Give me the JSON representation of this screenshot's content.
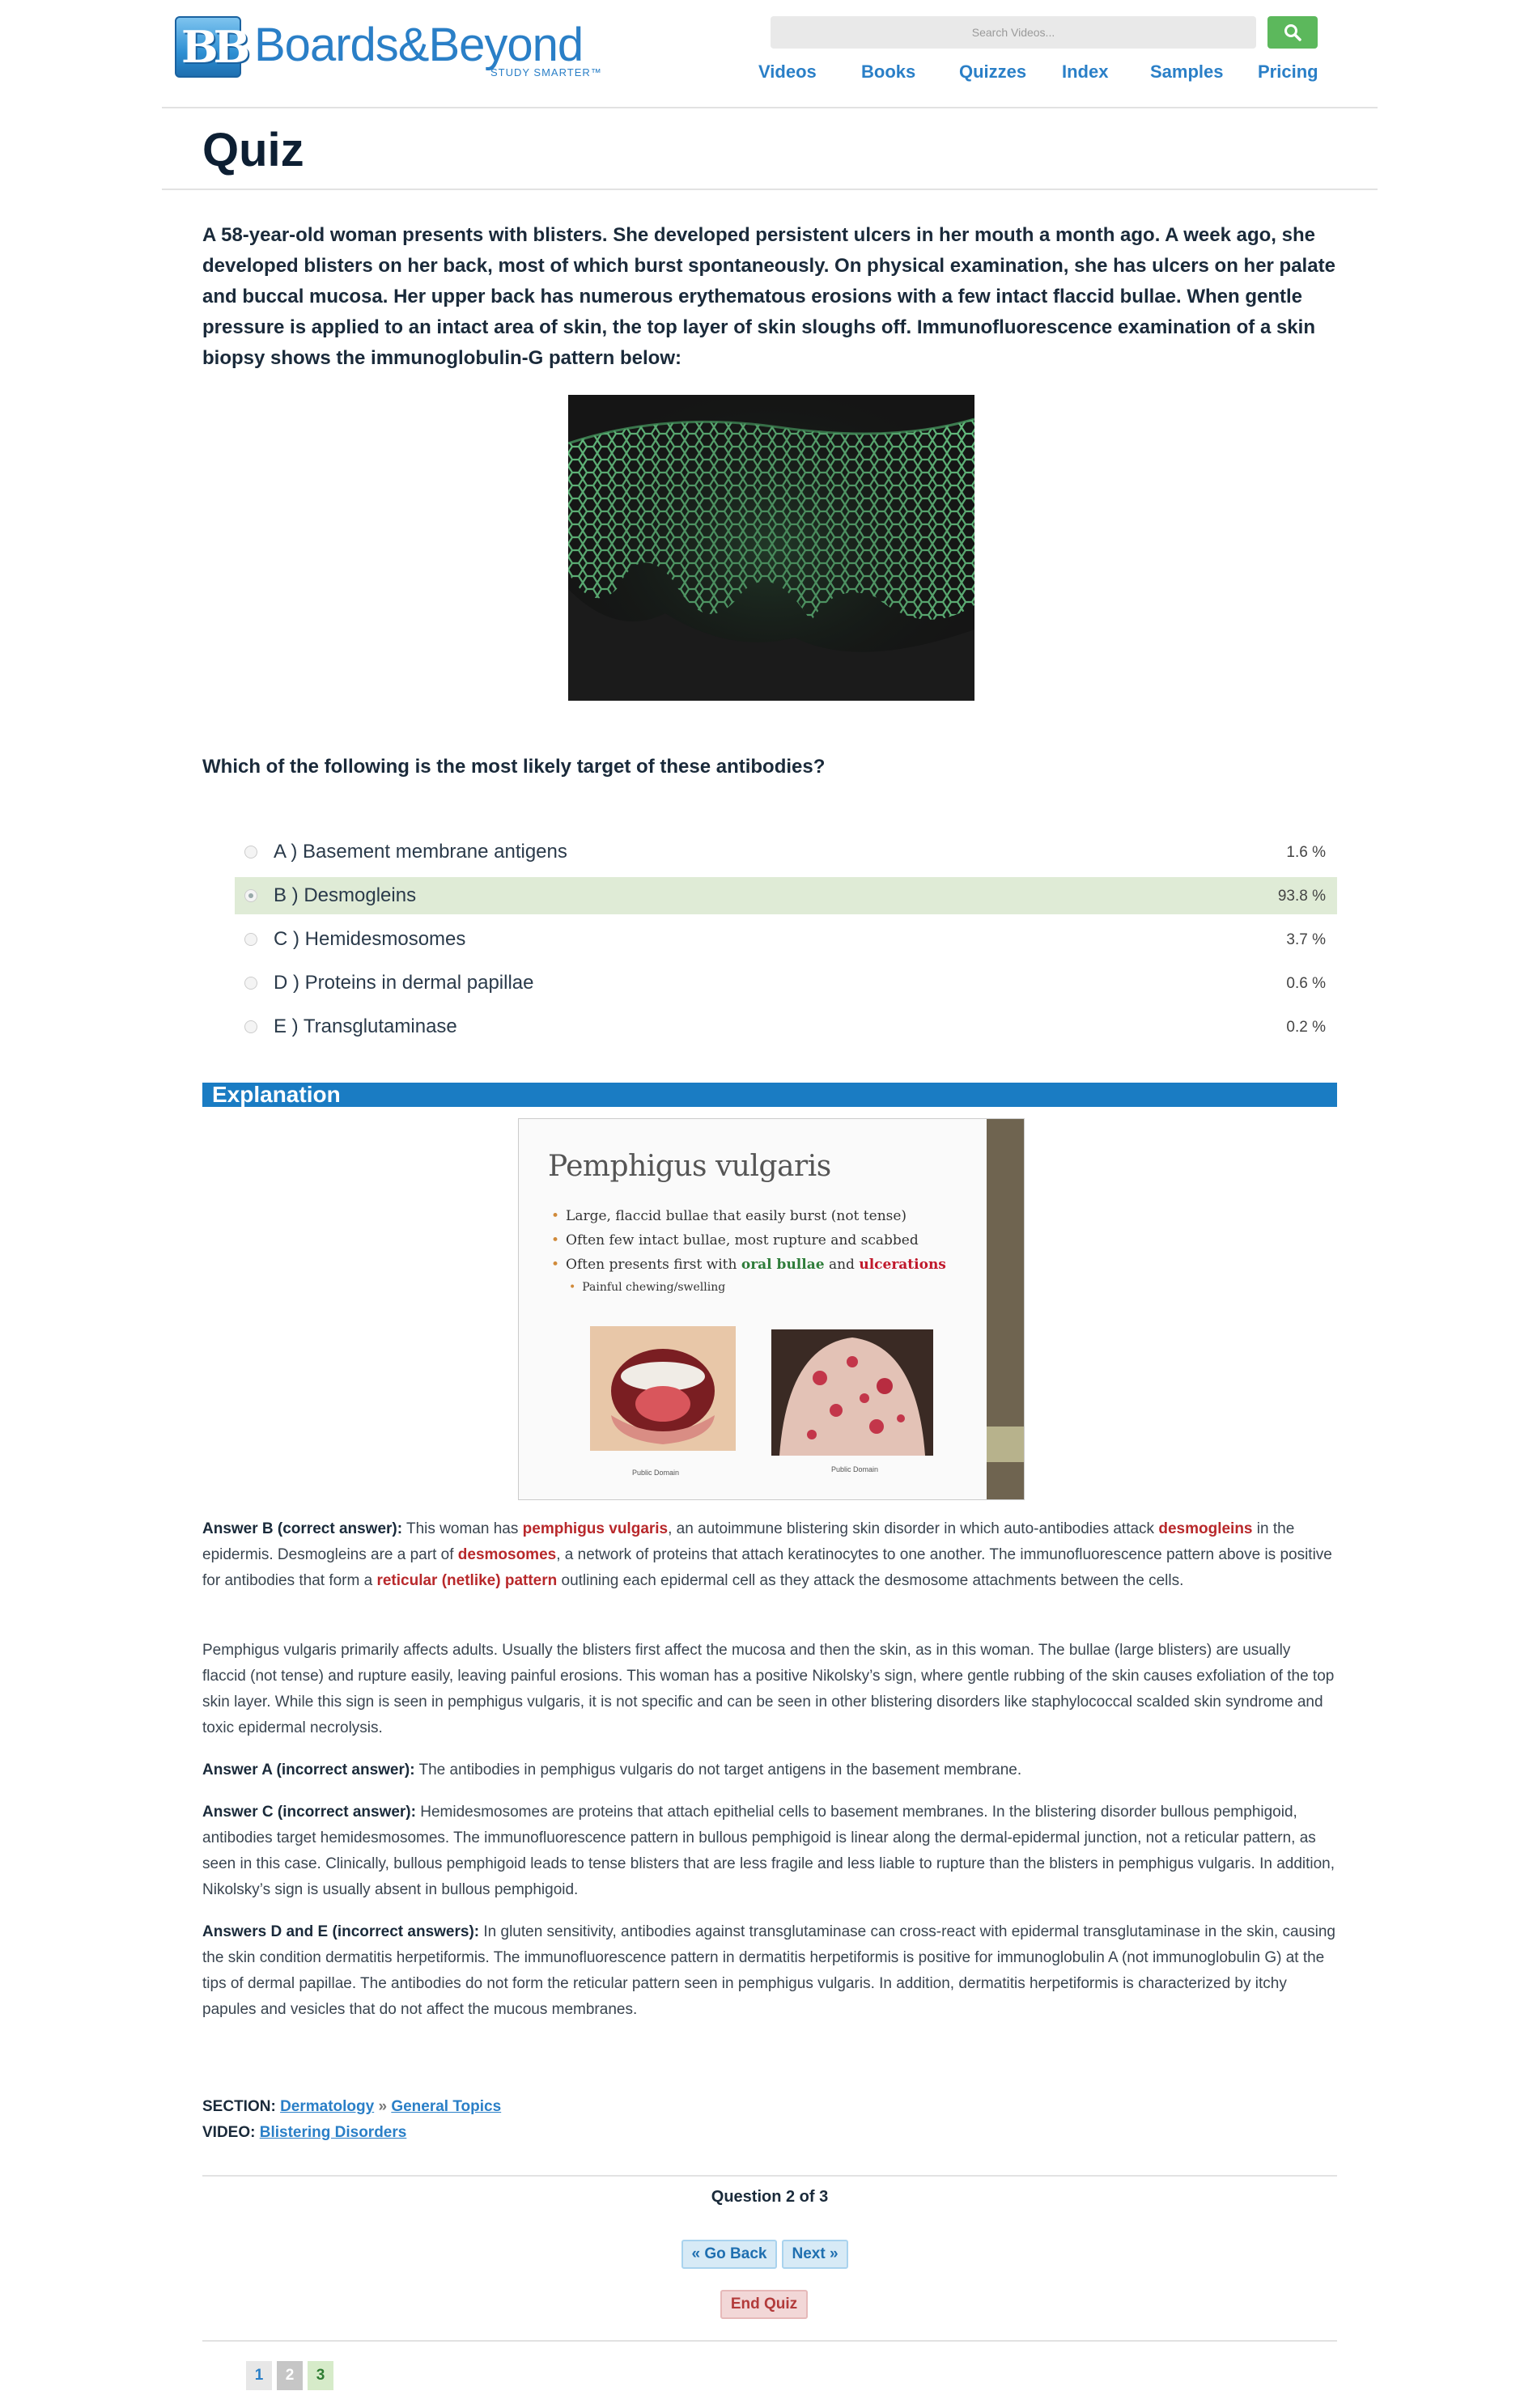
{
  "header": {
    "logo_text": "Boards&Beyond",
    "logo_tagline": "STUDY SMARTER™",
    "search_placeholder": "Search Videos...",
    "nav": [
      "Videos",
      "Books",
      "Quizzes",
      "Index",
      "Samples",
      "Pricing"
    ]
  },
  "page_title": "Quiz",
  "question": {
    "stem": "A 58-year-old woman presents with blisters. She developed persistent ulcers in her mouth a month ago. A week ago, she developed blisters on her back, most of which burst spontaneously. On physical examination, she has ulcers on her palate and buccal mucosa. Her upper back has numerous erythematous erosions with a few intact flaccid bullae. When gentle pressure is applied to an intact area of skin, the top layer of skin sloughs off. Immunofluorescence examination of a skin biopsy shows the immunoglobulin-G pattern below:",
    "prompt": "Which of the following is the most likely target of these antibodies?",
    "options": [
      {
        "label": "A ) Basement membrane antigens",
        "percent": "1.6 %"
      },
      {
        "label": "B ) Desmogleins",
        "percent": "93.8 %"
      },
      {
        "label": "C ) Hemidesmosomes",
        "percent": "3.7 %"
      },
      {
        "label": "D ) Proteins in dermal papillae",
        "percent": "0.6 %"
      },
      {
        "label": "E ) Transglutaminase",
        "percent": "0.2 %"
      }
    ]
  },
  "explanation": {
    "heading": "Explanation",
    "slide": {
      "title": "Pemphigus vulgaris",
      "bullet1": "Large, flaccid bullae that easily burst (not tense)",
      "bullet2": "Often few intact bullae, most rupture and scabbed",
      "bullet3_pre": "Often presents first with ",
      "bullet3_green": "oral bullae",
      "bullet3_mid": " and ",
      "bullet3_red": "ulcerations",
      "sub_bullet": "Painful chewing/swelling",
      "caption_left": "Public Domain",
      "caption_right": "Public Domain"
    },
    "p1": {
      "lead": "Answer B (correct answer):",
      "t1": " This woman has ",
      "h1": "pemphigus vulgaris",
      "t2": ", an autoimmune blistering skin disorder in which auto-antibodies attack ",
      "h2": "desmogleins",
      "t3": " in the epidermis. Desmogleins are a part of ",
      "h3": "desmosomes",
      "t4": ", a network of proteins that attach keratinocytes to one another. The immunofluorescence pattern above is positive for antibodies that form a ",
      "h4": "reticular (netlike) pattern",
      "t5": " outlining each epidermal cell as they attack the desmosome attachments between the cells."
    },
    "p2": "Pemphigus vulgaris primarily affects adults. Usually the blisters first affect the mucosa and then the skin, as in this woman. The bullae (large blisters) are usually flaccid (not tense) and rupture easily, leaving painful erosions. This woman has a positive Nikolsky’s sign, where gentle rubbing of the skin causes exfoliation of the top skin layer. While this sign is seen in pemphigus vulgaris, it is not specific and can be seen in other blistering disorders like staphylococcal scalded skin syndrome and toxic epidermal necrolysis.",
    "p3": {
      "lead": "Answer A (incorrect answer):",
      "text": " The antibodies in pemphigus vulgaris do not target antigens in the basement membrane."
    },
    "p4": {
      "lead": "Answer C (incorrect answer):",
      "text": " Hemidesmosomes are proteins that attach epithelial cells to basement membranes. In the blistering disorder bullous pemphigoid, antibodies target hemidesmosomes. The immunofluorescence pattern in bullous pemphigoid is linear along the dermal-epidermal junction, not a reticular pattern, as seen in this case. Clinically, bullous pemphigoid leads to tense blisters that are less fragile and less liable to rupture than the blisters in pemphigus vulgaris. In addition, Nikolsky’s sign is usually absent in bullous pemphigoid."
    },
    "p5": {
      "lead": "Answers D and E (incorrect answers):",
      "text": " In gluten sensitivity, antibodies against transglutaminase can cross-react with epidermal transglutaminase in the skin, causing the skin condition dermatitis herpetiformis. The immunofluorescence pattern in dermatitis herpetiformis is positive for immunoglobulin A (not immunoglobulin G) at the tips of dermal papillae. The antibodies do not form the reticular pattern seen in pemphigus vulgaris. In addition, dermatitis herpetiformis is characterized by itchy papules and vesicles that do not affect the mucous membranes."
    }
  },
  "meta": {
    "section_label": "SECTION:",
    "section_link": "Dermatology",
    "separator": " » ",
    "subsection_link": "General Topics",
    "video_label": "VIDEO:",
    "video_link": "Blistering Disorders"
  },
  "footer": {
    "question_count": "Question 2 of 3",
    "go_back": "« Go Back",
    "next": "Next »",
    "end_quiz": "End Quiz",
    "pages": [
      "1",
      "2",
      "3"
    ]
  }
}
